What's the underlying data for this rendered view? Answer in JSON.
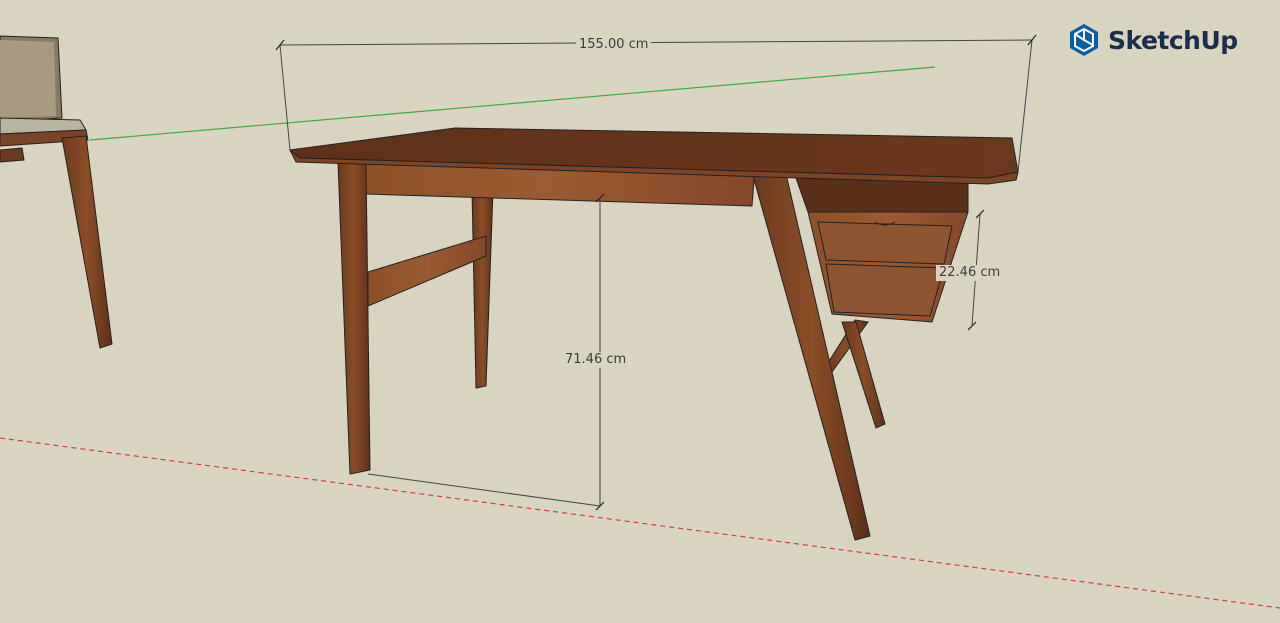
{
  "app": {
    "name": "SketchUp",
    "logo_icon": "sketchup-logo-icon",
    "brand_color": "#0a5ea8"
  },
  "model": {
    "background_color": "#d8d4c0",
    "wood_color": "#6e3d22",
    "axes": {
      "green_axis_color": "#3caa3c",
      "red_axis_color": "#d23c3c"
    }
  },
  "dimensions": {
    "width_label": "155.00 cm",
    "height_label": "71.46 cm",
    "drawer_label": "22.46 cm"
  }
}
